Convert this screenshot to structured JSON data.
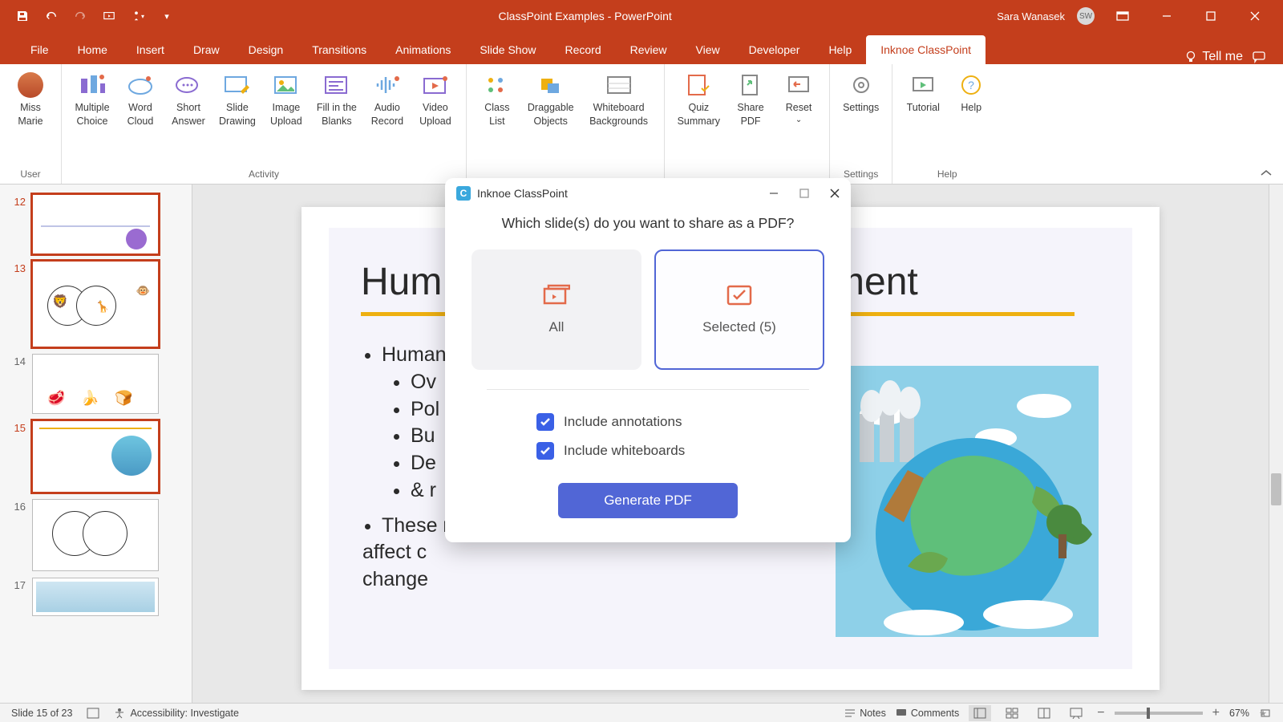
{
  "titlebar": {
    "doc_title": "ClassPoint Examples  -  PowerPoint",
    "user_name": "Sara Wanasek",
    "user_initials": "SW"
  },
  "tabs": {
    "file": "File",
    "home": "Home",
    "insert": "Insert",
    "draw": "Draw",
    "design": "Design",
    "transitions": "Transitions",
    "animations": "Animations",
    "slideshow": "Slide Show",
    "record": "Record",
    "review": "Review",
    "view": "View",
    "developer": "Developer",
    "help": "Help",
    "classpoint": "Inknoe ClassPoint",
    "tellme": "Tell me"
  },
  "ribbon": {
    "user_group": "User",
    "user_name_1": "Miss",
    "user_name_2": "Marie",
    "activity_group": "Activity",
    "mc1": "Multiple",
    "mc2": "Choice",
    "wc1": "Word",
    "wc2": "Cloud",
    "sa1": "Short",
    "sa2": "Answer",
    "sd1": "Slide",
    "sd2": "Drawing",
    "iu1": "Image",
    "iu2": "Upload",
    "fb1": "Fill in the",
    "fb2": "Blanks",
    "ar1": "Audio",
    "ar2": "Record",
    "vu1": "Video",
    "vu2": "Upload",
    "cl1": "Class",
    "cl2": "List",
    "do1": "Draggable",
    "do2": "Objects",
    "wb1": "Whiteboard",
    "wb2": "Backgrounds",
    "qs1": "Quiz",
    "qs2": "Summary",
    "sp1": "Share",
    "sp2": "PDF",
    "rs1": "Reset",
    "rs2": "⌄",
    "settings_group": "Settings",
    "settings": "Settings",
    "help_group": "Help",
    "tutorial": "Tutorial",
    "help": "Help"
  },
  "thumbs": {
    "n12": "12",
    "n13": "13",
    "n14": "14",
    "n15": "15",
    "n16": "16",
    "n17": "17"
  },
  "slide": {
    "title_left": "Hum",
    "title_right": "ment",
    "b1": "Human",
    "b2a": "Ov",
    "b2b": "Pol",
    "b2c": "Bu",
    "b2d": "De",
    "b2e": "& r",
    "b3a": "These r",
    "b3b": "affect c",
    "b3c": "change"
  },
  "dialog": {
    "title": "Inknoe ClassPoint",
    "prompt": "Which slide(s) do you want to share as a PDF?",
    "all": "All",
    "selected": "Selected (5)",
    "annotations": "Include annotations",
    "whiteboards": "Include whiteboards",
    "generate": "Generate PDF"
  },
  "status": {
    "slide_of": "Slide 15 of 23",
    "accessibility": "Accessibility: Investigate",
    "notes": "Notes",
    "comments": "Comments",
    "zoom": "67%"
  }
}
